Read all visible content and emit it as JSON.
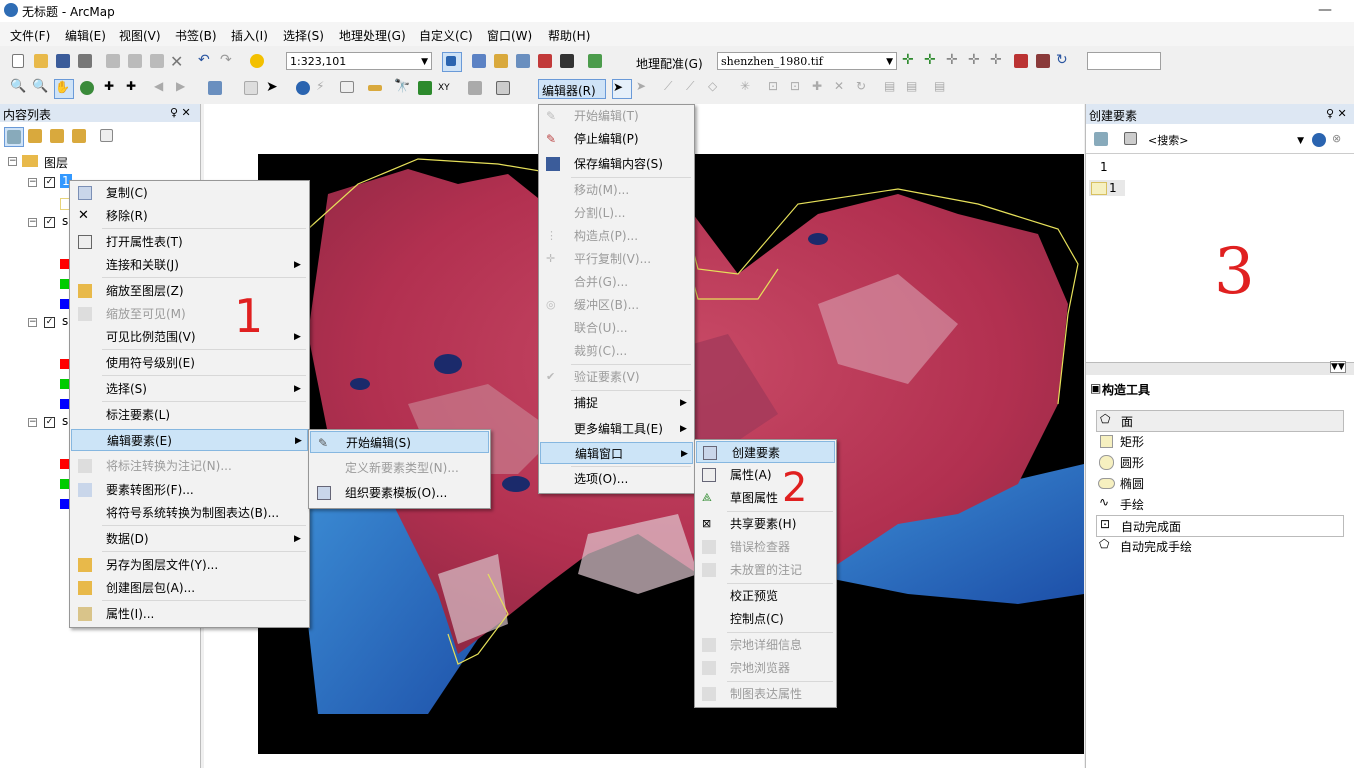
{
  "window": {
    "title": "无标题 - ArcMap",
    "minimize": "—"
  },
  "menubar": [
    "文件(F)",
    "编辑(E)",
    "视图(V)",
    "书签(B)",
    "插入(I)",
    "选择(S)",
    "地理处理(G)",
    "自定义(C)",
    "窗口(W)",
    "帮助(H)"
  ],
  "toolbar1": {
    "scale": "1:323,101",
    "georef_label": "地理配准(G)",
    "layer_combo": "shenzhen_1980.tif"
  },
  "toolbar2": {
    "editor_label": "编辑器(R)"
  },
  "toc": {
    "title": "内容列表",
    "pin": "♀ ✕",
    "root": "图层",
    "layer1": "1",
    "layer_s": "s"
  },
  "right_panel": {
    "title": "创建要素",
    "search_placeholder": "<搜索>",
    "template_group": "1",
    "template_item": "1",
    "annotation": "3",
    "construct_title": "构造工具",
    "tools": [
      "面",
      "矩形",
      "圆形",
      "椭圆",
      "手绘",
      "自动完成面",
      "自动完成手绘"
    ]
  },
  "layer_context_menu": {
    "items": [
      {
        "label": "复制(C)"
      },
      {
        "label": "移除(R)"
      },
      {
        "label": "打开属性表(T)"
      },
      {
        "label": "连接和关联(J)"
      },
      {
        "label": "缩放至图层(Z)"
      },
      {
        "label": "缩放至可见(M)"
      },
      {
        "label": "可见比例范围(V)"
      },
      {
        "label": "使用符号级别(E)"
      },
      {
        "label": "选择(S)"
      },
      {
        "label": "标注要素(L)"
      },
      {
        "label": "编辑要素(E)"
      },
      {
        "label": "将标注转换为注记(N)..."
      },
      {
        "label": "要素转图形(F)..."
      },
      {
        "label": "将符号系统转换为制图表达(B)..."
      },
      {
        "label": "数据(D)"
      },
      {
        "label": "另存为图层文件(Y)..."
      },
      {
        "label": "创建图层包(A)..."
      },
      {
        "label": "属性(I)..."
      }
    ],
    "annotation": "1"
  },
  "edit_features_submenu": {
    "items": [
      {
        "label": "开始编辑(S)"
      },
      {
        "label": "定义新要素类型(N)..."
      },
      {
        "label": "组织要素模板(O)..."
      }
    ]
  },
  "editor_menu": {
    "items": [
      {
        "label": "开始编辑(T)"
      },
      {
        "label": "停止编辑(P)"
      },
      {
        "label": "保存编辑内容(S)"
      },
      {
        "label": "移动(M)..."
      },
      {
        "label": "分割(L)..."
      },
      {
        "label": "构造点(P)..."
      },
      {
        "label": "平行复制(V)..."
      },
      {
        "label": "合并(G)..."
      },
      {
        "label": "缓冲区(B)..."
      },
      {
        "label": "联合(U)..."
      },
      {
        "label": "裁剪(C)..."
      },
      {
        "label": "验证要素(V)"
      },
      {
        "label": "捕捉"
      },
      {
        "label": "更多编辑工具(E)"
      },
      {
        "label": "编辑窗口"
      },
      {
        "label": "选项(O)..."
      }
    ]
  },
  "edit_windows_submenu": {
    "items": [
      {
        "label": "创建要素"
      },
      {
        "label": "属性(A)"
      },
      {
        "label": "草图属性"
      },
      {
        "label": "共享要素(H)"
      },
      {
        "label": "错误检查器"
      },
      {
        "label": "未放置的注记"
      },
      {
        "label": "校正预览"
      },
      {
        "label": "控制点(C)"
      },
      {
        "label": "宗地详细信息"
      },
      {
        "label": "宗地浏览器"
      },
      {
        "label": "制图表达属性"
      }
    ],
    "annotation": "2"
  },
  "colors": {
    "selection": "#cce4f7",
    "panel_header": "#dde7f3",
    "annotation_red": "#e02020"
  }
}
